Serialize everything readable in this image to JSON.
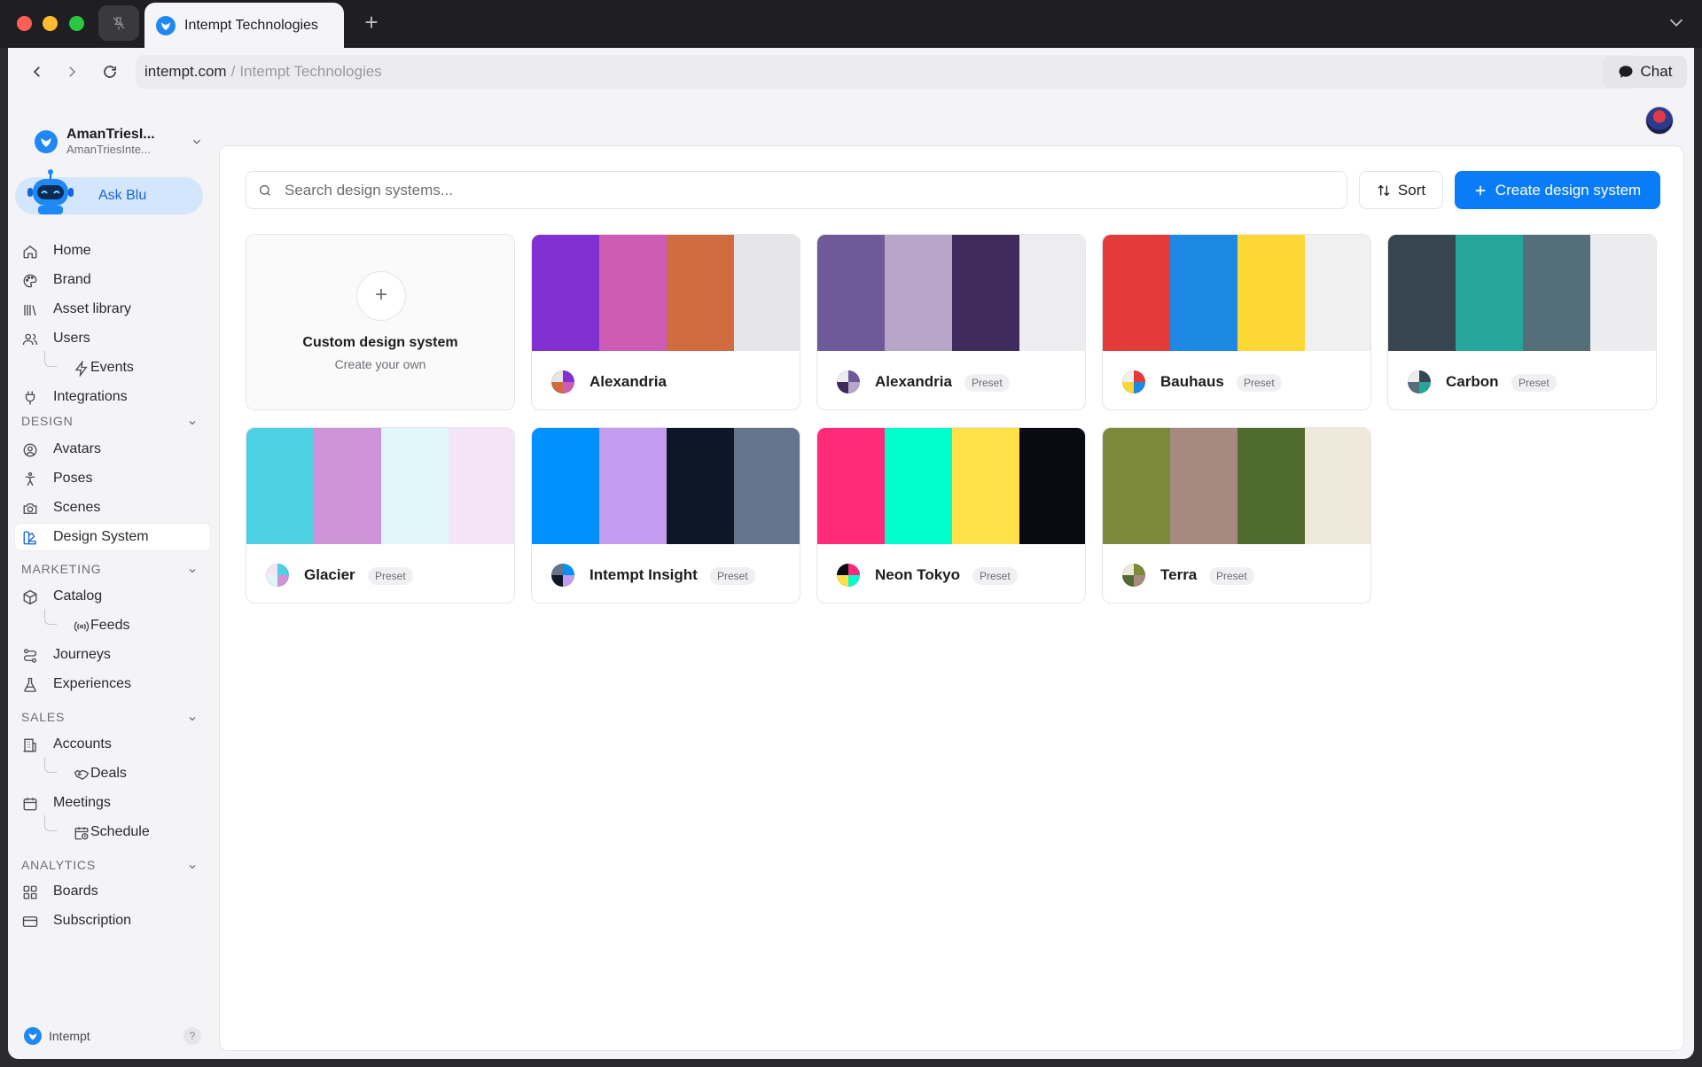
{
  "browser": {
    "tab_title": "Intempt Technologies",
    "url_host": "intempt.com",
    "url_separator": "/",
    "url_title": "Intempt Technologies",
    "chat_label": "Chat"
  },
  "org": {
    "name": "AmanTriesI...",
    "subtitle": "AmanTriesInte..."
  },
  "ask_blu": "Ask Blu",
  "nav": {
    "home": "Home",
    "brand": "Brand",
    "asset_library": "Asset library",
    "users": "Users",
    "events": "Events",
    "integrations": "Integrations",
    "design_section": "DESIGN",
    "avatars": "Avatars",
    "poses": "Poses",
    "scenes": "Scenes",
    "design_system": "Design System",
    "marketing_section": "MARKETING",
    "catalog": "Catalog",
    "feeds": "Feeds",
    "journeys": "Journeys",
    "experiences": "Experiences",
    "sales_section": "SALES",
    "accounts": "Accounts",
    "deals": "Deals",
    "meetings": "Meetings",
    "schedule": "Schedule",
    "analytics_section": "ANALYTICS",
    "boards": "Boards",
    "subscription": "Subscription"
  },
  "footer": {
    "brand": "Intempt",
    "help": "?"
  },
  "toolbar": {
    "search_placeholder": "Search design systems...",
    "sort_label": "Sort",
    "create_label": "Create design system"
  },
  "custom_card": {
    "title": "Custom design system",
    "subtitle": "Create your own"
  },
  "design_systems": [
    {
      "name": "Alexandria",
      "badge": "",
      "colors": [
        "#8330d3",
        "#ce5cb4",
        "#cf6c40",
        "#e6e6e8"
      ]
    },
    {
      "name": "Alexandria",
      "badge": "Preset",
      "colors": [
        "#6e5a98",
        "#b8a6c8",
        "#3e2b5c",
        "#ededf0"
      ]
    },
    {
      "name": "Bauhaus",
      "badge": "Preset",
      "colors": [
        "#e33b38",
        "#1e88e5",
        "#fdd835",
        "#f0f0f1"
      ]
    },
    {
      "name": "Carbon",
      "badge": "Preset",
      "colors": [
        "#36454f",
        "#26a69a",
        "#546e7a",
        "#ececee"
      ]
    },
    {
      "name": "Glacier",
      "badge": "Preset",
      "colors": [
        "#4dd0e1",
        "#ce93d8",
        "#e0f7fa",
        "#f3e5f5"
      ]
    },
    {
      "name": "Intempt Insight",
      "badge": "Preset",
      "colors": [
        "#0091ff",
        "#c39bef",
        "#0d1728",
        "#64748b"
      ]
    },
    {
      "name": "Neon Tokyo",
      "badge": "Preset",
      "colors": [
        "#ff2a7a",
        "#00ffcc",
        "#ffe047",
        "#0a0a12"
      ]
    },
    {
      "name": "Terra",
      "badge": "Preset",
      "colors": [
        "#7c8a3a",
        "#a68a7f",
        "#4f6b2e",
        "#efe9dc"
      ]
    }
  ]
}
